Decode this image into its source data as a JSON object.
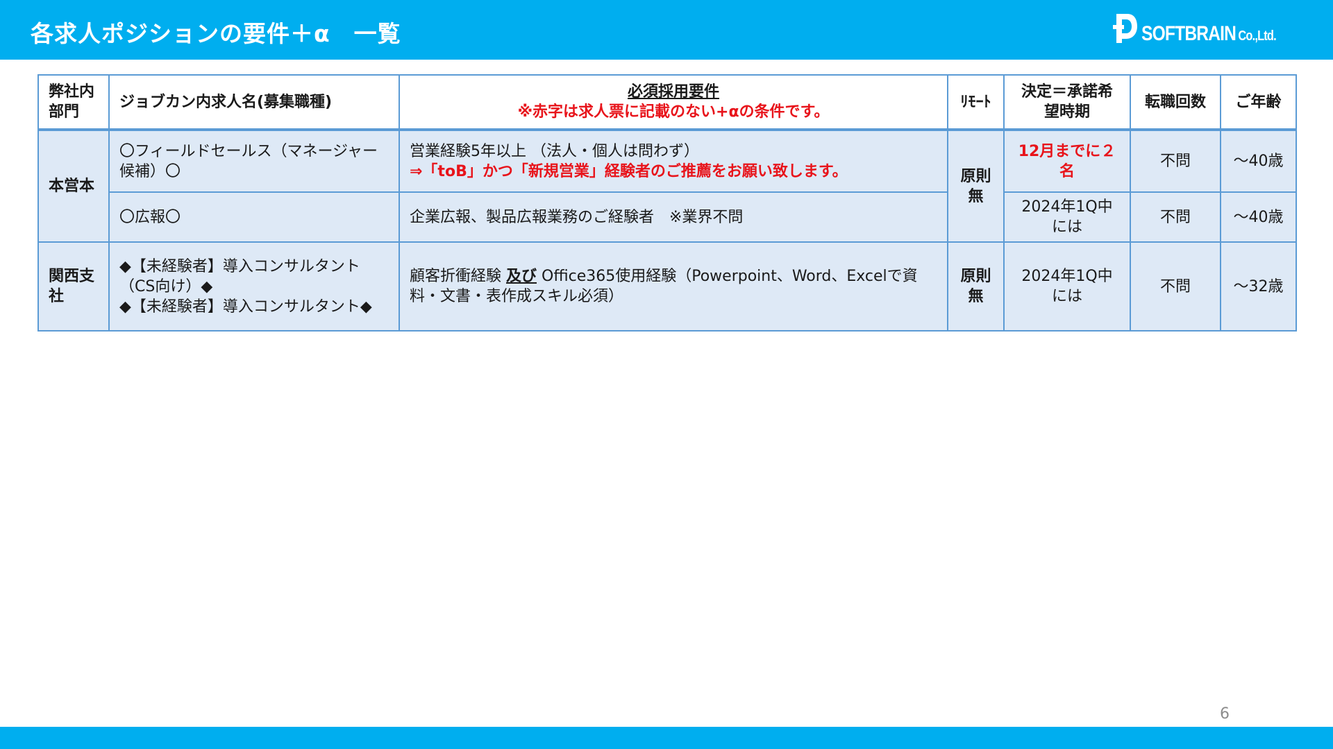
{
  "header": {
    "title": "各求人ポジションの要件＋α　一覧",
    "logo": {
      "text": "SOFTBRAIN",
      "suffix": "Co.,Ltd."
    },
    "bg_color": "#00aeef"
  },
  "table": {
    "columns": {
      "dept": "弊社内部門",
      "job_title": "ジョブカン内求人名(募集職種)",
      "req_title": "必須採用要件",
      "req_note": "※赤字は求人票に記載のない+αの条件です。",
      "remote": "ﾘﾓｰﾄ",
      "timing": "決定＝承諾希望時期",
      "job_changes": "転職回数",
      "age": "ご年齢"
    },
    "rows": [
      {
        "dept": "本営本",
        "job_title": "〇フィールドセールス（マネージャー候補）〇",
        "req_line1": "営業経験5年以上 （法人・個人は問わず）",
        "req_line2_red": "⇒「toB」かつ「新規営業」経験者のご推薦をお願い致します。",
        "remote": "原則無",
        "timing": "12月までに２名",
        "job_changes": "不問",
        "age": "～40歳"
      },
      {
        "job_title": "〇広報〇",
        "req_line1": "企業広報、製品広報業務のご経験者　※業界不問",
        "timing": "2024年1Q中には",
        "job_changes": "不問",
        "age": "～40歳"
      },
      {
        "dept": "関西支社",
        "job_title_line1": "◆【未経験者】導入コンサルタント（CS向け）◆",
        "job_title_line2": "◆【未経験者】導入コンサルタント◆",
        "req_pre": "顧客折衝経験 ",
        "req_emph": "及び",
        "req_post": " Office365使用経験（Powerpoint、Word、Excelで資料・文書・表作成スキル必須）",
        "remote": "原則無",
        "timing": "2024年1Q中には",
        "job_changes": "不問",
        "age": "～32歳"
      }
    ]
  },
  "footer": {
    "page_number": "6"
  }
}
